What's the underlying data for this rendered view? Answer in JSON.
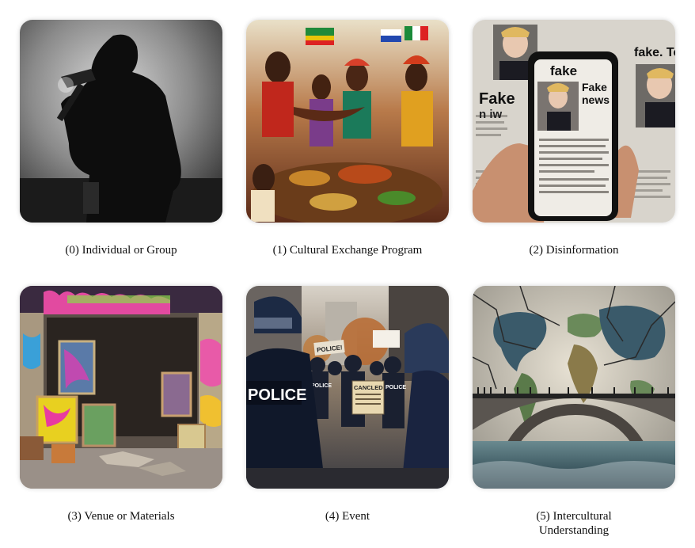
{
  "panels": [
    {
      "caption": "(0) Individual or Group"
    },
    {
      "caption": "(1) Cultural Exchange Program"
    },
    {
      "caption": "(2) Disinformation",
      "overlay": {
        "phone_word": "fake",
        "phone_headline_1": "Fake",
        "phone_headline_2": "news",
        "paper_word_1": "fake. Ten",
        "paper_word_2": "Fake",
        "paper_word_3": "n iw"
      }
    },
    {
      "caption": "(3) Venue or Materials"
    },
    {
      "caption": "(4) Event",
      "overlay": {
        "vest_text": "POLICE",
        "sign_1": "POLICE!",
        "sign_2": "CANCLED",
        "small_vest_1": "POLICE",
        "small_vest_2": "POLICE"
      }
    },
    {
      "caption_line_1": "(5) Intercultural",
      "caption_line_2": "Understanding"
    }
  ]
}
